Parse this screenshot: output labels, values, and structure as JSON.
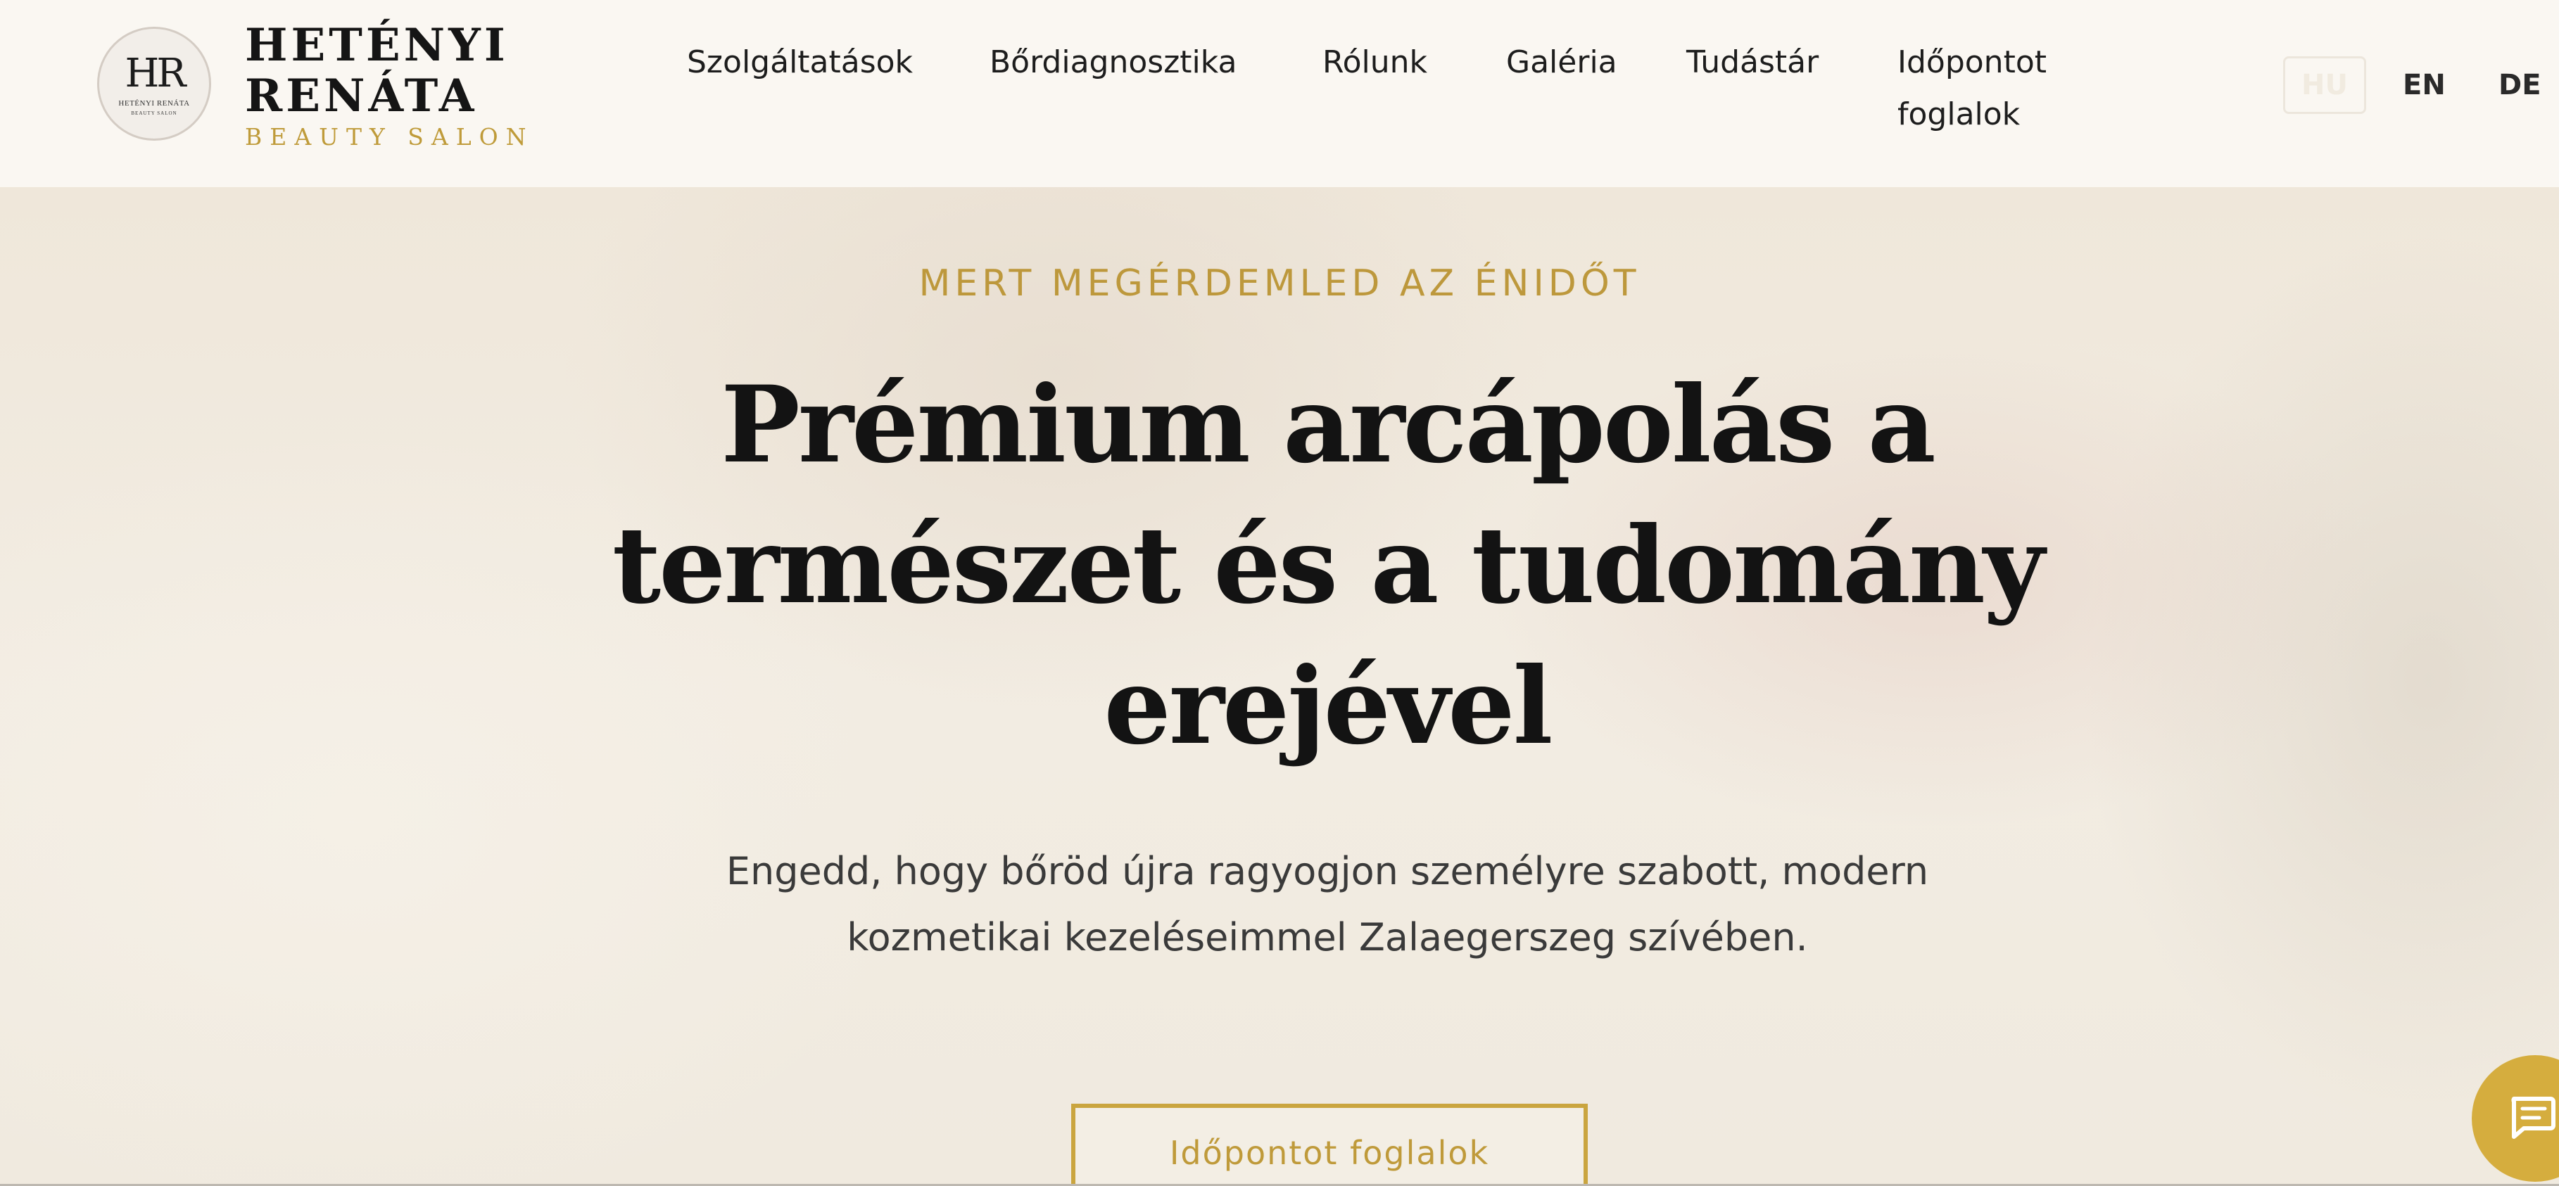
{
  "brand": {
    "monogram": "HR",
    "circle_text": "HETÉNYI RENÁTA",
    "circle_small": "BEAUTY SALON",
    "name_line1": "HETÉNYI",
    "name_line2": "RENÁTA",
    "tagline": "BEAUTY SALON"
  },
  "nav": {
    "items": [
      {
        "label": "Szolgáltatások"
      },
      {
        "label": "Bőrdiagnosztika"
      },
      {
        "label": "Rólunk"
      },
      {
        "label": "Galéria"
      },
      {
        "label": "Tudástár"
      },
      {
        "label": "Időpontot foglalok"
      }
    ]
  },
  "languages": {
    "active": "HU",
    "options": [
      "EN",
      "DE"
    ]
  },
  "hero": {
    "kicker": "MERT MEGÉRDEMLED AZ ÉNIDŐT",
    "headline": "Prémium arcápolás a természet és a tudomány erejével",
    "subtext": "Engedd, hogy bőröd újra ragyogjon személyre szabott, modern kozmetikai kezeléseimmel Zalaegerszeg szívében.",
    "cta_label": "Időpontot foglalok"
  },
  "colors": {
    "accent_gold": "#bf9b3a",
    "chat_gold": "#d5ad3e",
    "text_dark": "#131313"
  },
  "icons": {
    "chat": "chat-icon"
  }
}
